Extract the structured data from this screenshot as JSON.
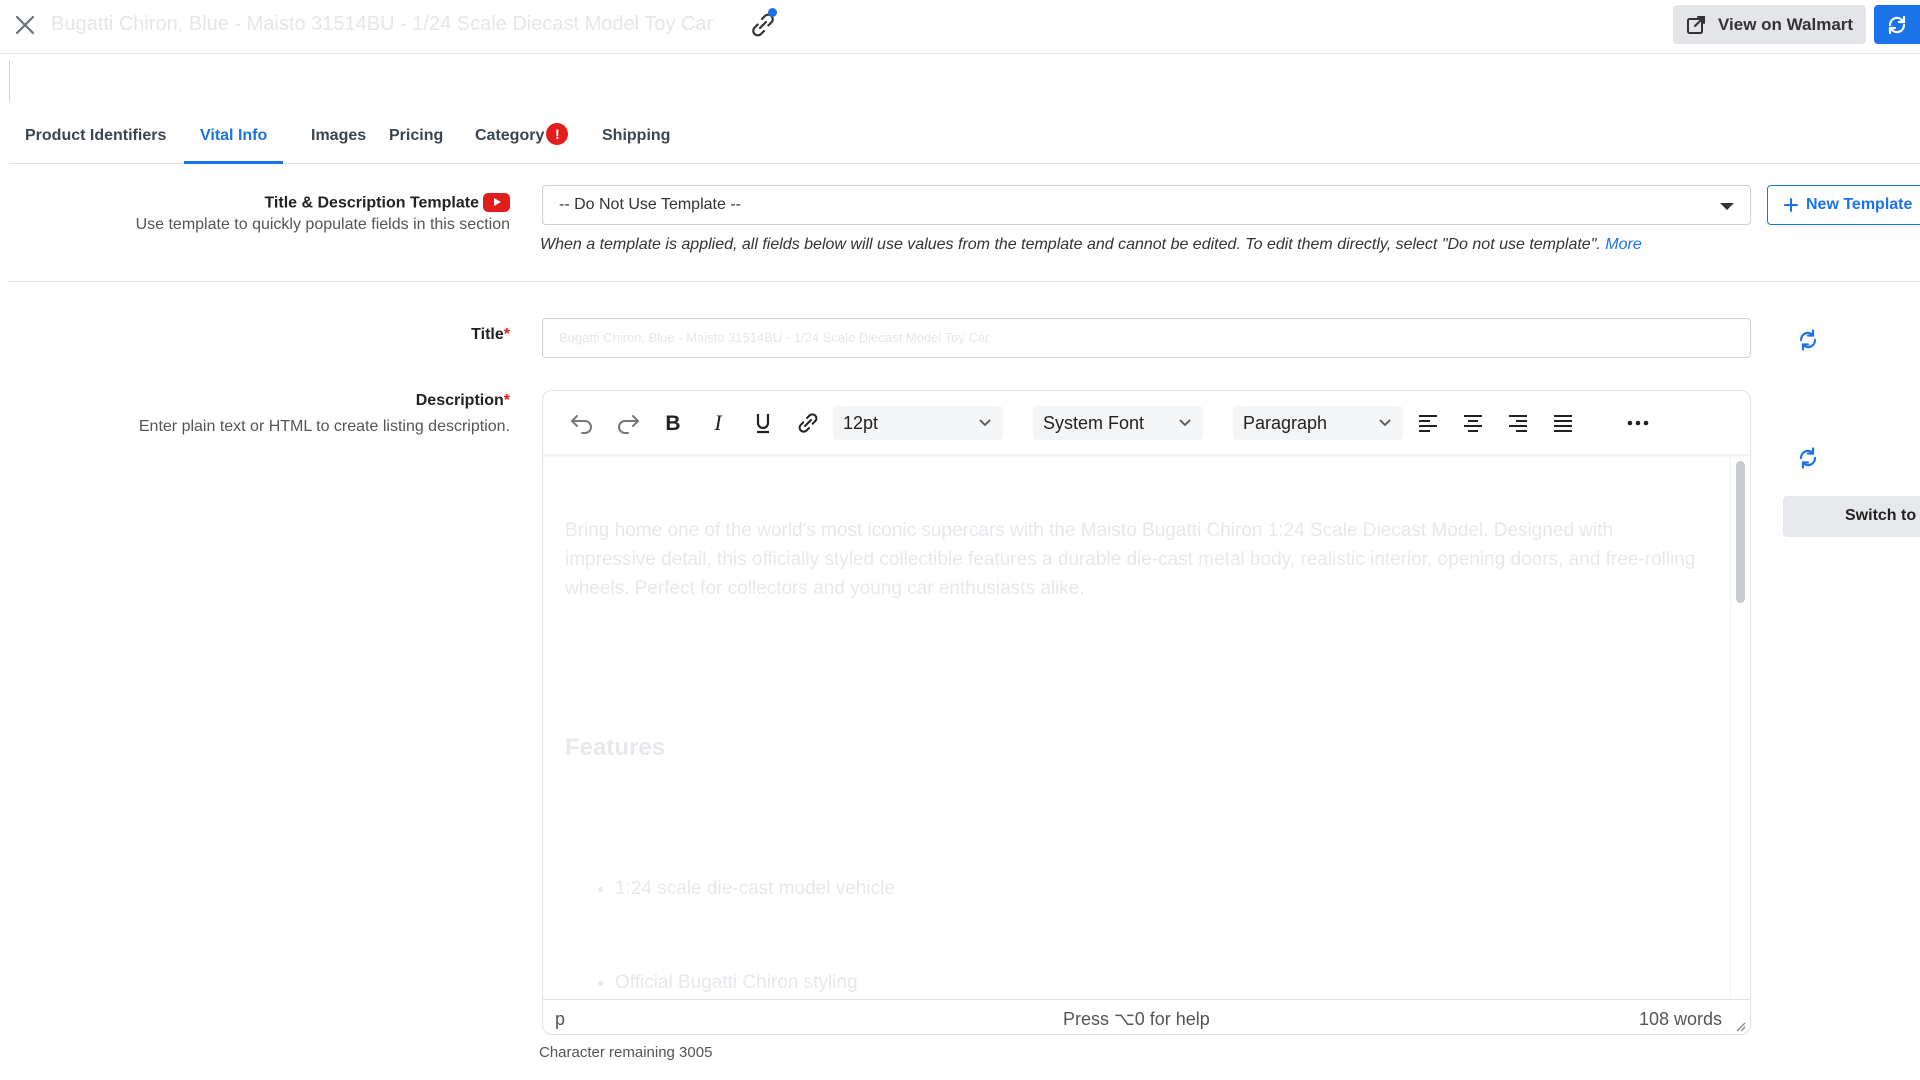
{
  "header": {
    "title": "Bugatti Chiron, Blue - Maisto 31514BU - 1/24 Scale Diecast Model Toy Car",
    "view_button_label": "View on Walmart"
  },
  "tabs": [
    {
      "label": "Product Identifiers",
      "active": false
    },
    {
      "label": "Vital Info",
      "active": true
    },
    {
      "label": "Images",
      "active": false
    },
    {
      "label": "Pricing",
      "active": false
    },
    {
      "label": "Category",
      "active": false,
      "badge": "!"
    },
    {
      "label": "Shipping",
      "active": false
    }
  ],
  "template": {
    "label": "Title & Description Template",
    "help": "Use template to quickly populate fields in this section",
    "selected": "-- Do Not Use Template --",
    "new_button_label": "New Template",
    "note": "When a template is applied, all fields below will use values from the template and cannot be edited. To edit them directly, select \"Do not use template\".",
    "note_link": "More"
  },
  "title_field": {
    "label": "Title",
    "required_mark": "*",
    "value": "Bugatti Chiron, Blue - Maisto 31514BU - 1/24 Scale Diecast Model Toy Car"
  },
  "description": {
    "label": "Description",
    "required_mark": "*",
    "help": "Enter plain text or HTML to create listing description.",
    "toolbar": {
      "font_size": "12pt",
      "font_family": "System Font",
      "block_format": "Paragraph"
    },
    "content": {
      "paragraph": "Bring home one of the world's most iconic supercars with the Maisto Bugatti Chiron 1:24 Scale Diecast Model. Designed with impressive detail, this officially styled collectible features a durable die-cast metal body, realistic interior, opening doors, and free-rolling wheels. Perfect for collectors and young car enthusiasts alike.",
      "heading": "Features",
      "bullets": [
        "1:24 scale die-cast model vehicle",
        "Official Bugatti Chiron styling"
      ]
    },
    "status": {
      "path": "p",
      "help": "Press ⌥0 for help",
      "words": "108 words"
    },
    "char_remaining": "Character remaining 3005",
    "switch_button_label": "Switch to HTML"
  },
  "colors": {
    "accent": "#1a73e8",
    "error": "#e31c1c",
    "button_gray": "#e3e5e8"
  },
  "icons": [
    "close-icon",
    "link-icon",
    "external-link-icon",
    "sync-icon",
    "youtube-icon",
    "chevron-down-icon",
    "plus-icon",
    "refresh-icon",
    "undo-icon",
    "redo-icon",
    "bold-icon",
    "italic-icon",
    "underline-icon",
    "link-icon",
    "align-left-icon",
    "align-center-icon",
    "align-right-icon",
    "align-justify-icon",
    "more-icon",
    "resize-handle-icon"
  ]
}
